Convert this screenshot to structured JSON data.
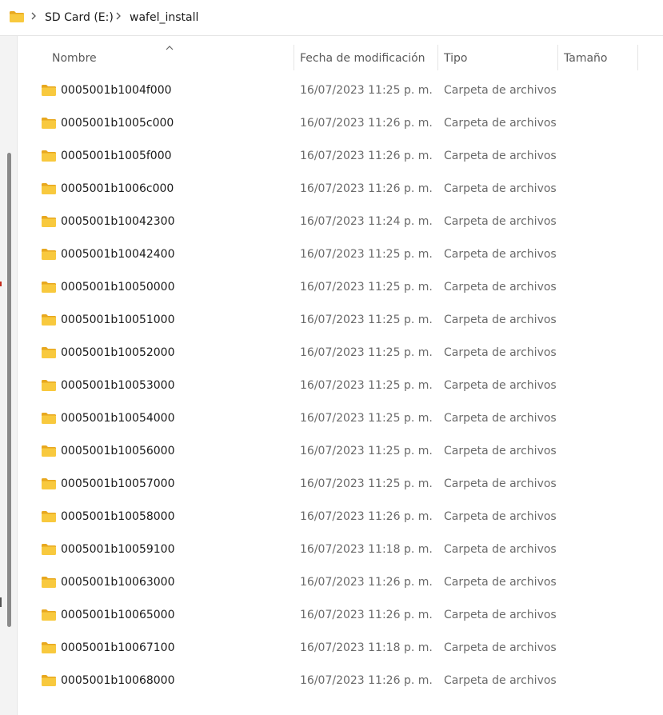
{
  "breadcrumb": {
    "items": [
      "SD Card (E:)",
      "wafel_install"
    ]
  },
  "columns": {
    "name": "Nombre",
    "modified": "Fecha de modificación",
    "type": "Tipo",
    "size": "Tamaño",
    "sorted_by": "name"
  },
  "icons": {
    "folder": "folder-icon",
    "separator": "chevron-right-icon",
    "sort": "sort-ascending-icon"
  },
  "colors": {
    "folder_fill": "#f8c93e",
    "folder_back": "#e8a81f"
  },
  "files": [
    {
      "name": "0005001b1004f000",
      "modified": "16/07/2023 11:25 p. m.",
      "type": "Carpeta de archivos",
      "size": ""
    },
    {
      "name": "0005001b1005c000",
      "modified": "16/07/2023 11:26 p. m.",
      "type": "Carpeta de archivos",
      "size": ""
    },
    {
      "name": "0005001b1005f000",
      "modified": "16/07/2023 11:26 p. m.",
      "type": "Carpeta de archivos",
      "size": ""
    },
    {
      "name": "0005001b1006c000",
      "modified": "16/07/2023 11:26 p. m.",
      "type": "Carpeta de archivos",
      "size": ""
    },
    {
      "name": "0005001b10042300",
      "modified": "16/07/2023 11:24 p. m.",
      "type": "Carpeta de archivos",
      "size": ""
    },
    {
      "name": "0005001b10042400",
      "modified": "16/07/2023 11:25 p. m.",
      "type": "Carpeta de archivos",
      "size": ""
    },
    {
      "name": "0005001b10050000",
      "modified": "16/07/2023 11:25 p. m.",
      "type": "Carpeta de archivos",
      "size": ""
    },
    {
      "name": "0005001b10051000",
      "modified": "16/07/2023 11:25 p. m.",
      "type": "Carpeta de archivos",
      "size": ""
    },
    {
      "name": "0005001b10052000",
      "modified": "16/07/2023 11:25 p. m.",
      "type": "Carpeta de archivos",
      "size": ""
    },
    {
      "name": "0005001b10053000",
      "modified": "16/07/2023 11:25 p. m.",
      "type": "Carpeta de archivos",
      "size": ""
    },
    {
      "name": "0005001b10054000",
      "modified": "16/07/2023 11:25 p. m.",
      "type": "Carpeta de archivos",
      "size": ""
    },
    {
      "name": "0005001b10056000",
      "modified": "16/07/2023 11:25 p. m.",
      "type": "Carpeta de archivos",
      "size": ""
    },
    {
      "name": "0005001b10057000",
      "modified": "16/07/2023 11:25 p. m.",
      "type": "Carpeta de archivos",
      "size": ""
    },
    {
      "name": "0005001b10058000",
      "modified": "16/07/2023 11:26 p. m.",
      "type": "Carpeta de archivos",
      "size": ""
    },
    {
      "name": "0005001b10059100",
      "modified": "16/07/2023 11:18 p. m.",
      "type": "Carpeta de archivos",
      "size": ""
    },
    {
      "name": "0005001b10063000",
      "modified": "16/07/2023 11:26 p. m.",
      "type": "Carpeta de archivos",
      "size": ""
    },
    {
      "name": "0005001b10065000",
      "modified": "16/07/2023 11:26 p. m.",
      "type": "Carpeta de archivos",
      "size": ""
    },
    {
      "name": "0005001b10067100",
      "modified": "16/07/2023 11:18 p. m.",
      "type": "Carpeta de archivos",
      "size": ""
    },
    {
      "name": "0005001b10068000",
      "modified": "16/07/2023 11:26 p. m.",
      "type": "Carpeta de archivos",
      "size": ""
    }
  ]
}
